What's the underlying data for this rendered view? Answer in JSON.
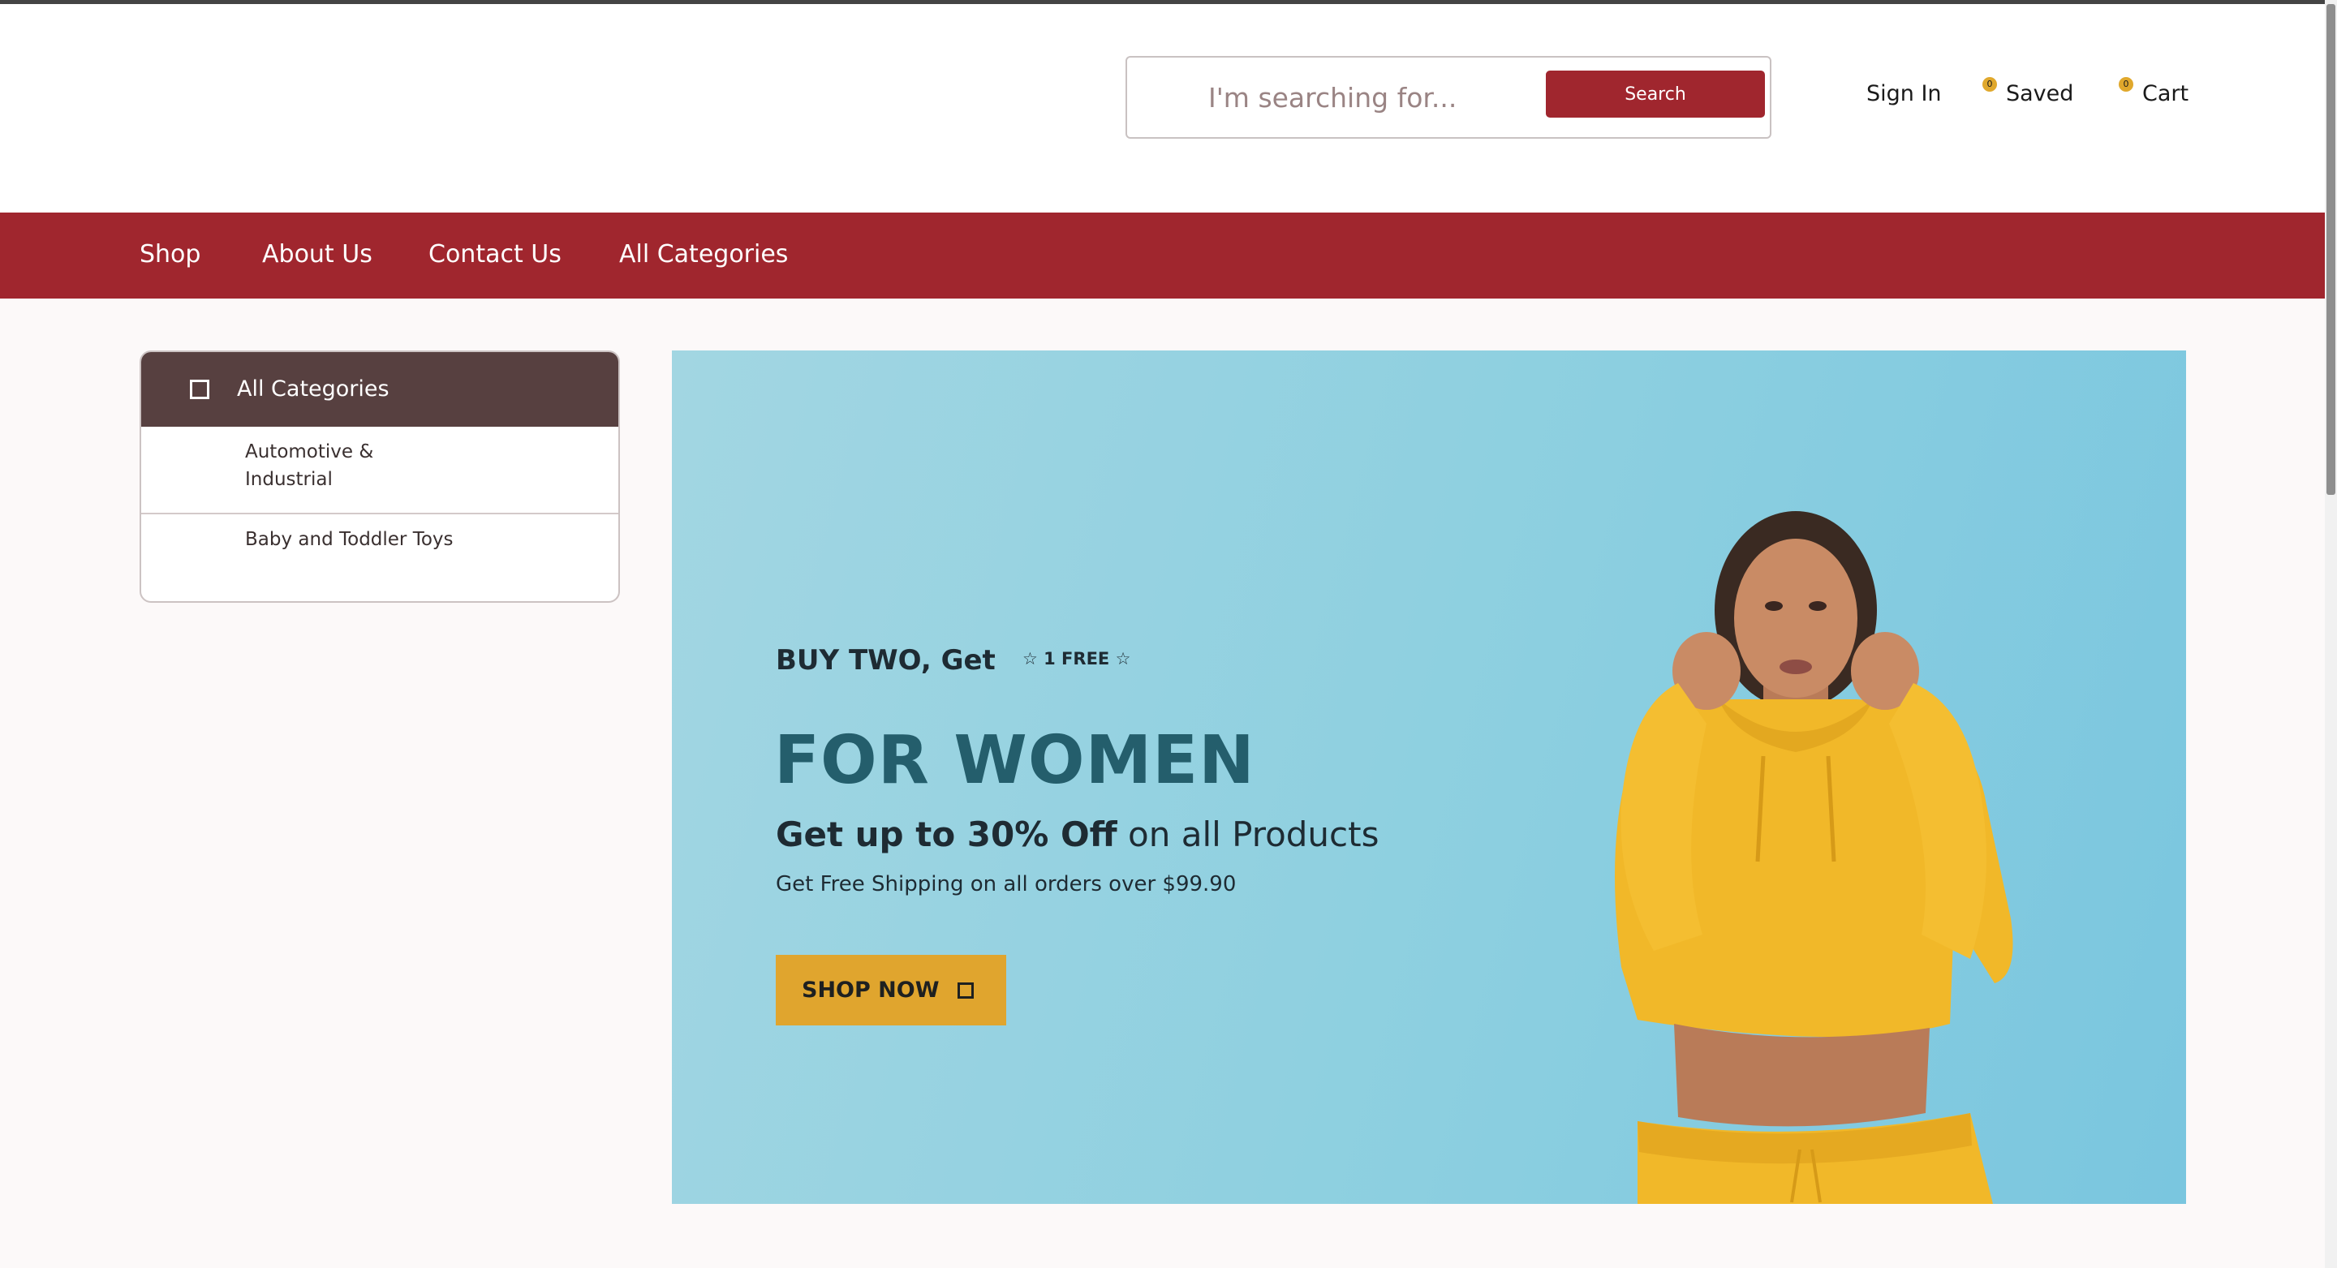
{
  "header": {
    "search": {
      "placeholder": "I'm searching for...",
      "button_label": "Search"
    },
    "sign_in": "Sign In",
    "saved": {
      "label": "Saved",
      "count": "0"
    },
    "cart": {
      "label": "Cart",
      "count": "0"
    }
  },
  "nav": {
    "items": [
      {
        "label": "Shop"
      },
      {
        "label": "About Us"
      },
      {
        "label": "Contact Us"
      },
      {
        "label": "All Categories"
      }
    ]
  },
  "sidebar": {
    "title": "All Categories",
    "items": [
      {
        "label": "Automotive & Industrial"
      },
      {
        "label": "Baby and Toddler Toys"
      }
    ]
  },
  "banner": {
    "pretitle": "BUY TWO, Get",
    "free_tag": "☆ 1 FREE ☆",
    "headline": "FOR WOMEN",
    "offer_bold": "Get up to 30% Off",
    "offer_rest": " on all Products",
    "shipping": "Get Free Shipping on all orders over $99.90",
    "cta": "SHOP NOW"
  },
  "colors": {
    "brand_red": "#a0262e",
    "category_header": "#574040",
    "banner_bg": "#8ccfe0",
    "cta_yellow": "#e0a52e",
    "headline_teal": "#245e6c"
  }
}
